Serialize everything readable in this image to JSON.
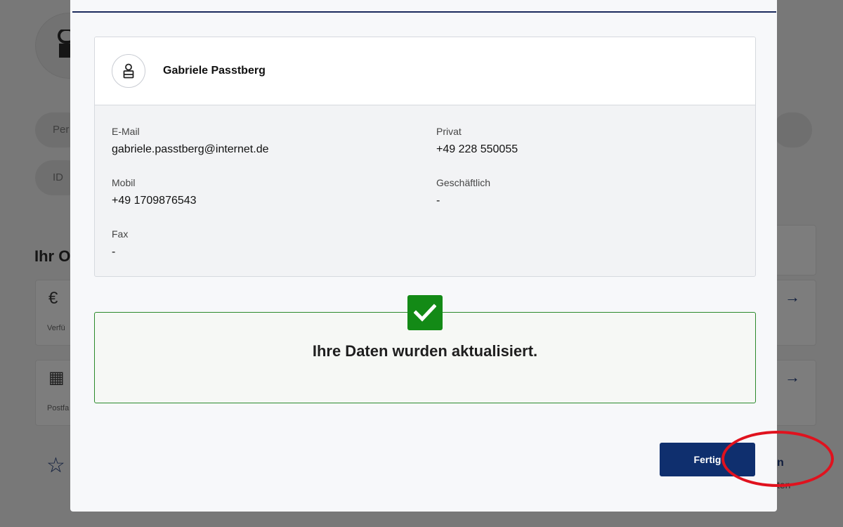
{
  "background": {
    "pill_personal": "Per",
    "pill_id": "ID ",
    "section_heading": "Ihr O",
    "card1_label": "Verfü",
    "card2_label": "Postfa",
    "right_text": "ten",
    "right_bold": "n"
  },
  "contact": {
    "name": "Gabriele Passtberg",
    "fields": {
      "email": {
        "label": "E-Mail",
        "value": "gabriele.passtberg@internet.de"
      },
      "private": {
        "label": "Privat",
        "value": "+49 228 550055"
      },
      "mobile": {
        "label": "Mobil",
        "value": "+49 1709876543"
      },
      "business": {
        "label": "Geschäftlich",
        "value": "-"
      },
      "fax": {
        "label": "Fax",
        "value": "-"
      }
    }
  },
  "success": {
    "message": "Ihre Daten wurden aktualisiert."
  },
  "actions": {
    "done_label": "Fertig"
  },
  "colors": {
    "brand_navy": "#0f2f6e",
    "success_green": "#138a16",
    "highlight_red": "#e0121e"
  }
}
